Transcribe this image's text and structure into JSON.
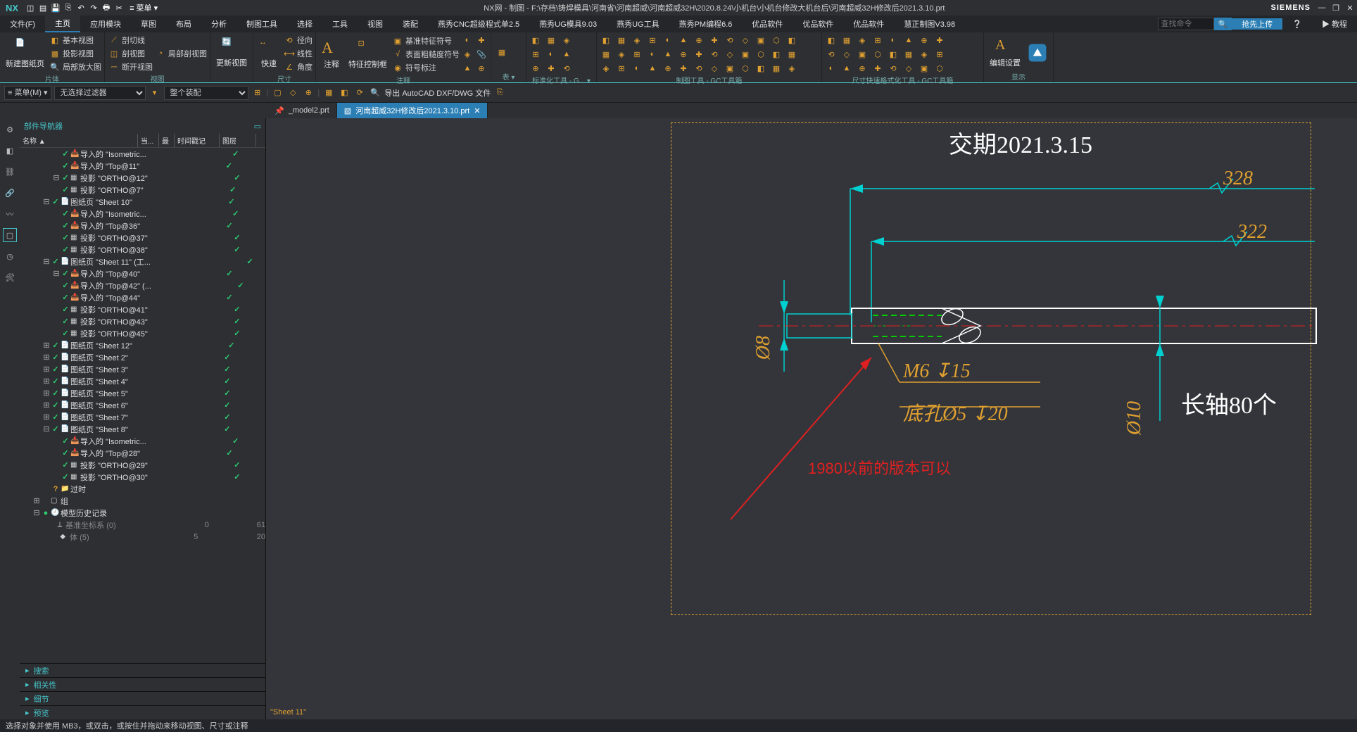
{
  "app": {
    "logo": "NX",
    "title": "NX网 - 制图 - F:\\存档\\铸焊模具\\河南省\\河南超威\\河南超威32H\\2020.8.24\\小机台\\小机台修改大机台后\\河南超威32H修改后2021.3.10.prt",
    "brand": "SIEMENS"
  },
  "menu": {
    "tabs": [
      "文件(F)",
      "主页",
      "应用模块",
      "草图",
      "布局",
      "分析",
      "制图工具",
      "选择",
      "工具",
      "视图",
      "装配",
      "燕秀CNC超级程式单2.5",
      "燕秀UG模具9.03",
      "燕秀UG工具",
      "燕秀PM编程6.6",
      "优品软件",
      "优品软件",
      "优品软件",
      "慧正制图V3.98"
    ],
    "simple": "≡ 菜单 ▾",
    "active": 1,
    "search_ph": "查找命令",
    "upload": "抢先上传",
    "tutorial": "教程"
  },
  "ribbon": {
    "grp1": {
      "btn": "新建图纸页",
      "lbl": "片体",
      "r0": "基本视图",
      "r1": "投影视图",
      "r2": "局部放大图"
    },
    "grp2": {
      "r0": "剖切线",
      "r1": "剖视图",
      "r2": "断开视图",
      "r3": "局部剖视图",
      "lbl": "视图"
    },
    "grp3": {
      "btn": "更新视图"
    },
    "grp4": {
      "btn": "快速",
      "r0": "径向",
      "r1": "线性",
      "r2": "角度",
      "lbl": "尺寸"
    },
    "grp5": {
      "btn": "注释",
      "r0": "基准特征符号",
      "r1": "表面粗糙度符号",
      "r2": "符号标注",
      "c": "特征控制框",
      "lbl": "注释"
    },
    "grp6": {
      "lbl": "表 ▾"
    },
    "grp7": {
      "lbl": "标准化工具 - G... ▾"
    },
    "grp8": {
      "lbl": "制图工具 - GC工具箱"
    },
    "grp9": {
      "lbl": "尺寸快速格式化工具 - GC工具箱"
    },
    "grp10": {
      "btn": "编辑设置",
      "lbl": "显示"
    }
  },
  "subbar": {
    "m": "≡ 菜单(M) ▾",
    "f1": "无选择过滤器",
    "f2": "整个装配",
    "exp": "导出 AutoCAD DXF/DWG 文件"
  },
  "tabs": [
    {
      "name": "_model2.prt",
      "pin": true
    },
    {
      "name": "河南超威32H修改后2021.3.10.prt",
      "active": true
    }
  ],
  "nav": {
    "title": "部件导航器",
    "cols": {
      "name": "名称 ▲",
      "a": "当...",
      "b": "最",
      "c": "时间戳记",
      "d": "图层"
    }
  },
  "tree": [
    {
      "d": 3,
      "chk": 1,
      "txt": "导入的 \"Isometric...",
      "ico": "imp"
    },
    {
      "d": 3,
      "chk": 1,
      "txt": "导入的 \"Top@11\"",
      "ico": "imp"
    },
    {
      "d": 3,
      "chk": 1,
      "txt": "投影 \"ORTHO@12\"",
      "ico": "proj",
      "tw": "⊟"
    },
    {
      "d": 3,
      "chk": 1,
      "txt": "投影 \"ORTHO@7\"",
      "ico": "proj"
    },
    {
      "d": 2,
      "chk": 1,
      "txt": "图纸页 \"Sheet 10\"",
      "ico": "sheet",
      "tw": "⊟"
    },
    {
      "d": 3,
      "chk": 1,
      "txt": "导入的 \"Isometric...",
      "ico": "imp"
    },
    {
      "d": 3,
      "chk": 1,
      "txt": "导入的 \"Top@36\"",
      "ico": "imp"
    },
    {
      "d": 3,
      "chk": 1,
      "txt": "投影 \"ORTHO@37\"",
      "ico": "proj"
    },
    {
      "d": 3,
      "chk": 1,
      "txt": "投影 \"ORTHO@38\"",
      "ico": "proj"
    },
    {
      "d": 2,
      "chk": 1,
      "txt": "图纸页 \"Sheet 11\" (工...",
      "ico": "sheet",
      "tw": "⊟"
    },
    {
      "d": 3,
      "chk": 1,
      "txt": "导入的 \"Top@40\"",
      "ico": "imp",
      "tw": "⊟"
    },
    {
      "d": 3,
      "chk": 1,
      "txt": "导入的 \"Top@42\" (...",
      "ico": "imp"
    },
    {
      "d": 3,
      "chk": 1,
      "txt": "导入的 \"Top@44\"",
      "ico": "imp"
    },
    {
      "d": 3,
      "chk": 1,
      "txt": "投影 \"ORTHO@41\"",
      "ico": "proj"
    },
    {
      "d": 3,
      "chk": 1,
      "txt": "投影 \"ORTHO@43\"",
      "ico": "proj"
    },
    {
      "d": 3,
      "chk": 1,
      "txt": "投影 \"ORTHO@45\"",
      "ico": "proj"
    },
    {
      "d": 2,
      "chk": 1,
      "txt": "图纸页 \"Sheet 12\"",
      "ico": "sheet",
      "tw": "⊞"
    },
    {
      "d": 2,
      "chk": 1,
      "txt": "图纸页 \"Sheet 2\"",
      "ico": "sheet",
      "tw": "⊞"
    },
    {
      "d": 2,
      "chk": 1,
      "txt": "图纸页 \"Sheet 3\"",
      "ico": "sheet",
      "tw": "⊞"
    },
    {
      "d": 2,
      "chk": 1,
      "txt": "图纸页 \"Sheet 4\"",
      "ico": "sheet",
      "tw": "⊞"
    },
    {
      "d": 2,
      "chk": 1,
      "txt": "图纸页 \"Sheet 5\"",
      "ico": "sheet",
      "tw": "⊞"
    },
    {
      "d": 2,
      "chk": 1,
      "txt": "图纸页 \"Sheet 6\"",
      "ico": "sheet",
      "tw": "⊞"
    },
    {
      "d": 2,
      "chk": 1,
      "txt": "图纸页 \"Sheet 7\"",
      "ico": "sheet",
      "tw": "⊞"
    },
    {
      "d": 2,
      "chk": 1,
      "txt": "图纸页 \"Sheet 8\"",
      "ico": "sheet",
      "tw": "⊟"
    },
    {
      "d": 3,
      "chk": 1,
      "txt": "导入的 \"Isometric...",
      "ico": "imp"
    },
    {
      "d": 3,
      "chk": 1,
      "txt": "导入的 \"Top@28\"",
      "ico": "imp"
    },
    {
      "d": 3,
      "chk": 1,
      "txt": "投影 \"ORTHO@29\"",
      "ico": "proj"
    },
    {
      "d": 3,
      "chk": 1,
      "txt": "投影 \"ORTHO@30\"",
      "ico": "proj"
    },
    {
      "d": 2,
      "txt": "过时",
      "ico": "fold",
      "q": 1
    },
    {
      "d": 1,
      "txt": "组",
      "ico": "grp",
      "tw": "⊞"
    },
    {
      "d": 1,
      "txt": "模型历史记录",
      "ico": "hist",
      "tw": "⊟",
      "g": 1
    },
    {
      "d": 2,
      "txt": "基准坐标系 (0)",
      "ico": "csys",
      "dim": 1,
      "v0": "0",
      "v1": "61"
    },
    {
      "d": 2,
      "txt": "体 (5)",
      "ico": "body",
      "dim": 1,
      "v0": "5",
      "v1": "20"
    }
  ],
  "acc": [
    "搜索",
    "相关性",
    "细节",
    "预览"
  ],
  "canvas": {
    "date": "交期2021.3.15",
    "d328": "328",
    "d322": "322",
    "d10": "Ø10",
    "d8": "Ø8",
    "m6": "M6  ↧15",
    "dk": "底孔Ø5  ↧20",
    "note": "1980以前的版本可以",
    "qty": "长轴80个",
    "sheet": "\"Sheet 11\""
  },
  "status": "选择对象并使用 MB3，或双击，或按住并拖动来移动视图、尺寸或注释"
}
